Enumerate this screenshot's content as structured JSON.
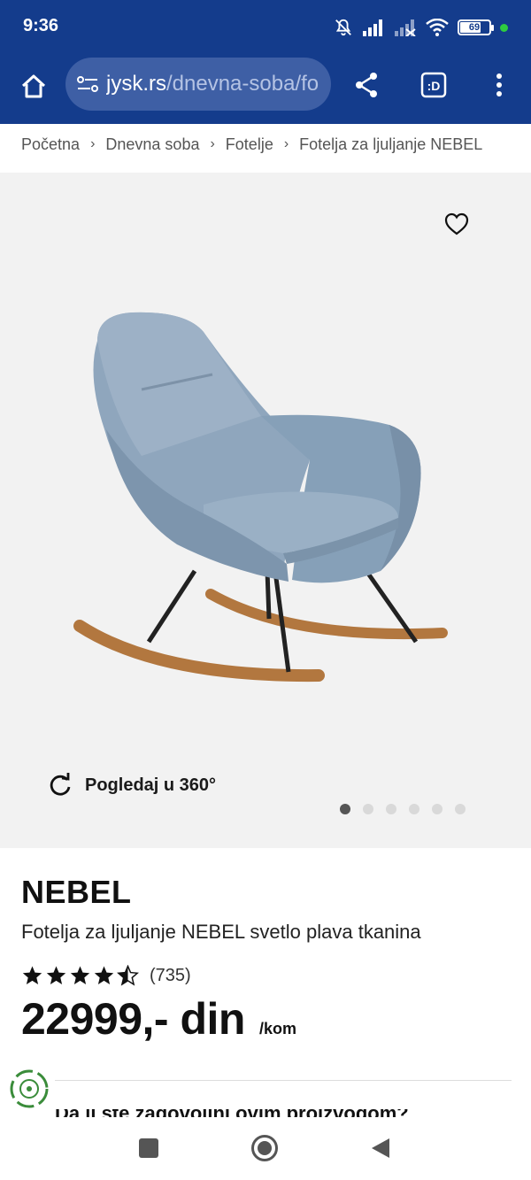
{
  "status": {
    "time": "9:36",
    "battery": "69"
  },
  "browser": {
    "url_domain": "jysk.rs",
    "url_path": "/dnevna-soba/fotelje/fotelja-za-ljuljanje-nebel"
  },
  "breadcrumb": [
    {
      "label": "Početna"
    },
    {
      "label": "Dnevna soba"
    },
    {
      "label": "Fotelje"
    },
    {
      "label": "Fotelja za ljuljanje NEBEL"
    }
  ],
  "gallery": {
    "view360_label": "Pogledaj u 360°",
    "dots_total": 6,
    "dot_active": 1
  },
  "product": {
    "name": "NEBEL",
    "description": "Fotelja za ljuljanje NEBEL svetlo plava tkanina",
    "rating": 4.5,
    "review_count": "(735)",
    "price": "22999,- din",
    "price_unit": "/kom"
  },
  "partial_heading": "Da li ste zadovoljni ovim proizvodom?",
  "colors": {
    "header_bg": "#143c8c",
    "url_bar_bg": "#3e5fa5",
    "gallery_bg": "#f2f2f2",
    "chair_fabric": "#8fa6bd",
    "rocker_wood": "#b2773f",
    "eco_green": "#3a8c3a"
  },
  "icons": [
    "bell-off-icon",
    "signal-icon",
    "wifi-icon",
    "battery-icon",
    "home-icon",
    "site-settings-icon",
    "share-icon",
    "tab-switcher-icon",
    "more-vert-icon",
    "heart-icon",
    "rotate-360-icon",
    "star-icon",
    "eco-badge-icon"
  ]
}
